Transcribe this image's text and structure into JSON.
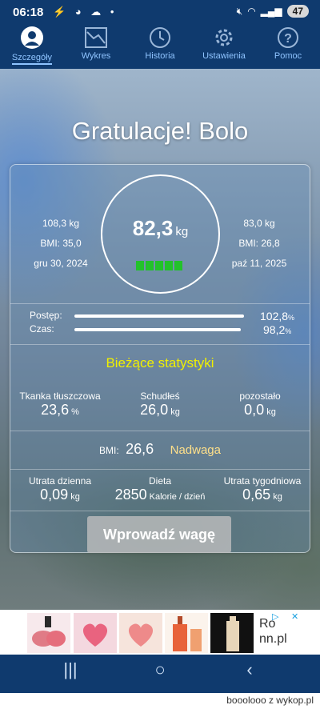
{
  "status": {
    "time": "06:18",
    "icons": "⚡ ◕ ☁ •",
    "battery": "47"
  },
  "tabs": [
    {
      "label": "Szczegóły",
      "icon": "person-icon"
    },
    {
      "label": "Wykres",
      "icon": "chart-icon"
    },
    {
      "label": "Historia",
      "icon": "clock-icon"
    },
    {
      "label": "Ustawienia",
      "icon": "gear-icon"
    },
    {
      "label": "Pomoc",
      "icon": "help-icon"
    }
  ],
  "title": "Gratulacje! Bolo",
  "start": {
    "weight": "108,3 kg",
    "bmi": "BMI: 35,0",
    "date": "gru 30, 2024"
  },
  "current": {
    "weight": "82,3",
    "unit": "kg",
    "level_bars": 5
  },
  "goal": {
    "weight": "83,0 kg",
    "bmi": "BMI: 26,8",
    "date": "paź 11, 2025"
  },
  "progress": {
    "label": "Postęp:",
    "value": "102,8",
    "fraction": 1.0
  },
  "time": {
    "label": "Czas:",
    "value": "98,2",
    "fraction": 0.982
  },
  "percent_sign": "%",
  "stats_title": "Bieżące statystyki",
  "fat": {
    "label": "Tkanka tłuszczowa",
    "value": "23,6",
    "unit": "%"
  },
  "lost": {
    "label": "Schudłeś",
    "value": "26,0",
    "unit": "kg"
  },
  "remaining": {
    "label": "pozostało",
    "value": "0,0",
    "unit": "kg"
  },
  "bmi": {
    "label": "BMI:",
    "value": "26,6",
    "category": "Nadwaga"
  },
  "daily": {
    "label": "Utrata dzienna",
    "value": "0,09",
    "unit": "kg"
  },
  "diet": {
    "label": "Dieta",
    "value": "2850",
    "unit": "Kalorie / dzień"
  },
  "weekly": {
    "label": "Utrata tygodniowa",
    "value": "0,65",
    "unit": "kg"
  },
  "enter_button": "Wprowadź wagę",
  "ad": {
    "text_line1": "Ro",
    "text_line2": "nn.pl"
  },
  "watermark": "booolooo z wykop.pl",
  "colors": {
    "accent": "#8fc4ff",
    "stats_title": "#f0f000",
    "bmi_category": "#ffe08a",
    "bars": "#22c22a"
  }
}
